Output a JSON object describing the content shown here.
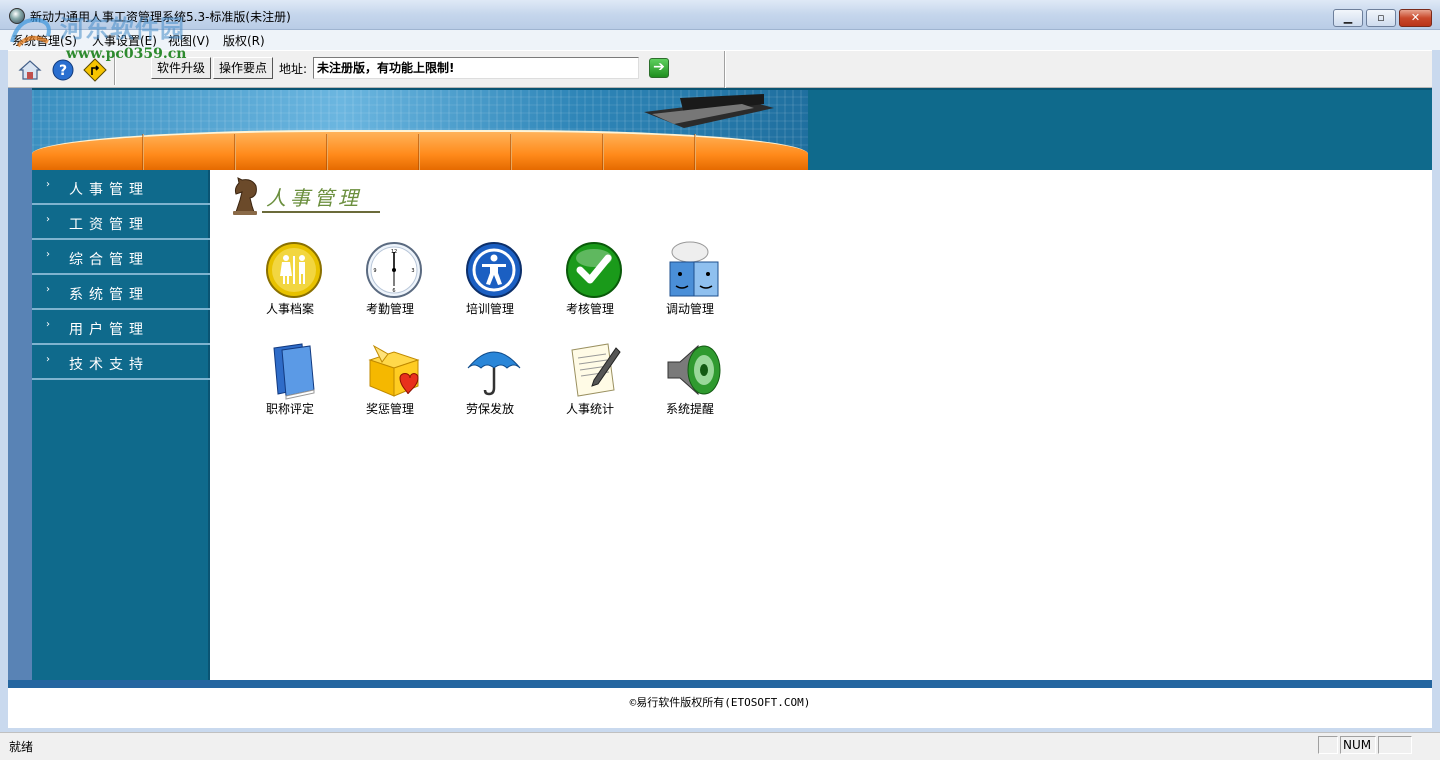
{
  "window": {
    "title": "新动力通用人事工资管理系统5.3-标准版(未注册)",
    "minimize_glyph": "▁",
    "maximize_glyph": "▫",
    "close_glyph": "✕"
  },
  "watermark": {
    "site_name": "河东软件园",
    "url": "www.pc0359.cn"
  },
  "menu": [
    {
      "label": "系统管理(S)"
    },
    {
      "label": "人事设置(E)"
    },
    {
      "label": "视图(V)"
    },
    {
      "label": "版权(R)"
    }
  ],
  "toolbar": {
    "icons": [
      "home-icon",
      "help-icon",
      "road-sign-icon"
    ],
    "upgrade_label": "软件升级",
    "tips_label": "操作要点",
    "address_label": "地址:",
    "address_value": "未注册版，有功能上限制!",
    "go_icon": "➔"
  },
  "sidebar": {
    "items": [
      {
        "label": "人事管理",
        "arrow": "›"
      },
      {
        "label": "工资管理",
        "arrow": "›"
      },
      {
        "label": "综合管理",
        "arrow": "›"
      },
      {
        "label": "系统管理",
        "arrow": "›"
      },
      {
        "label": "用户管理",
        "arrow": "›"
      },
      {
        "label": "技术支持",
        "arrow": "›"
      }
    ]
  },
  "content": {
    "section_title": "人事管理",
    "apps": [
      {
        "label": "人事档案",
        "icon": "restroom-icon"
      },
      {
        "label": "考勤管理",
        "icon": "clock-icon"
      },
      {
        "label": "培训管理",
        "icon": "accessibility-icon"
      },
      {
        "label": "考核管理",
        "icon": "checkmark-icon"
      },
      {
        "label": "调动管理",
        "icon": "chat-faces-icon"
      },
      {
        "label": "职称评定",
        "icon": "books-icon"
      },
      {
        "label": "奖惩管理",
        "icon": "gift-heart-icon"
      },
      {
        "label": "劳保发放",
        "icon": "umbrella-icon"
      },
      {
        "label": "人事统计",
        "icon": "document-pen-icon"
      },
      {
        "label": "系统提醒",
        "icon": "speaker-icon"
      }
    ]
  },
  "footer": {
    "copyright": "©易行软件版权所有(ETOSOFT.COM)"
  },
  "statusbar": {
    "status": "就绪",
    "num_indicator": "NUM"
  },
  "colors": {
    "frame_teal": "#0f6a8c",
    "left_strip": "#5983b5",
    "banner_orange": "#ff8a1a",
    "footer_blue": "#2566a0"
  }
}
